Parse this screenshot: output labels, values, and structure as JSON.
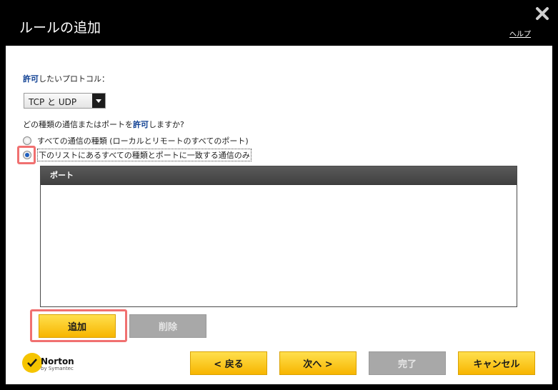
{
  "window": {
    "title": "ルールの追加",
    "help_link": "ヘルプ"
  },
  "protocol": {
    "label_highlight": "許可",
    "label_rest": "したいプロトコル：",
    "selected_value": "TCP と UDP"
  },
  "question": {
    "prefix": "どの種類の通信またはポートを",
    "highlight": "許可",
    "suffix": "しますか?"
  },
  "radio_options": [
    {
      "label": "すべての通信の種類 (ローカルとリモートのすべてのポート)",
      "checked": false
    },
    {
      "label": "下のリストにあるすべての種類とポートに一致する通信のみ",
      "checked": true
    }
  ],
  "port_list": {
    "header": "ポート",
    "rows": []
  },
  "actions": {
    "add_label": "追加",
    "delete_label": "削除"
  },
  "nav": {
    "back_label": "< 戻る",
    "next_label": "次へ >",
    "finish_label": "完了",
    "cancel_label": "キャンセル"
  },
  "brand": {
    "name": "Norton",
    "sub": "by Symantec"
  },
  "colors": {
    "accent_yellow": "#f7b500",
    "highlight_red": "#f07070",
    "keyword_blue": "#0b3d91",
    "radio_selected": "#1f5fbf"
  }
}
